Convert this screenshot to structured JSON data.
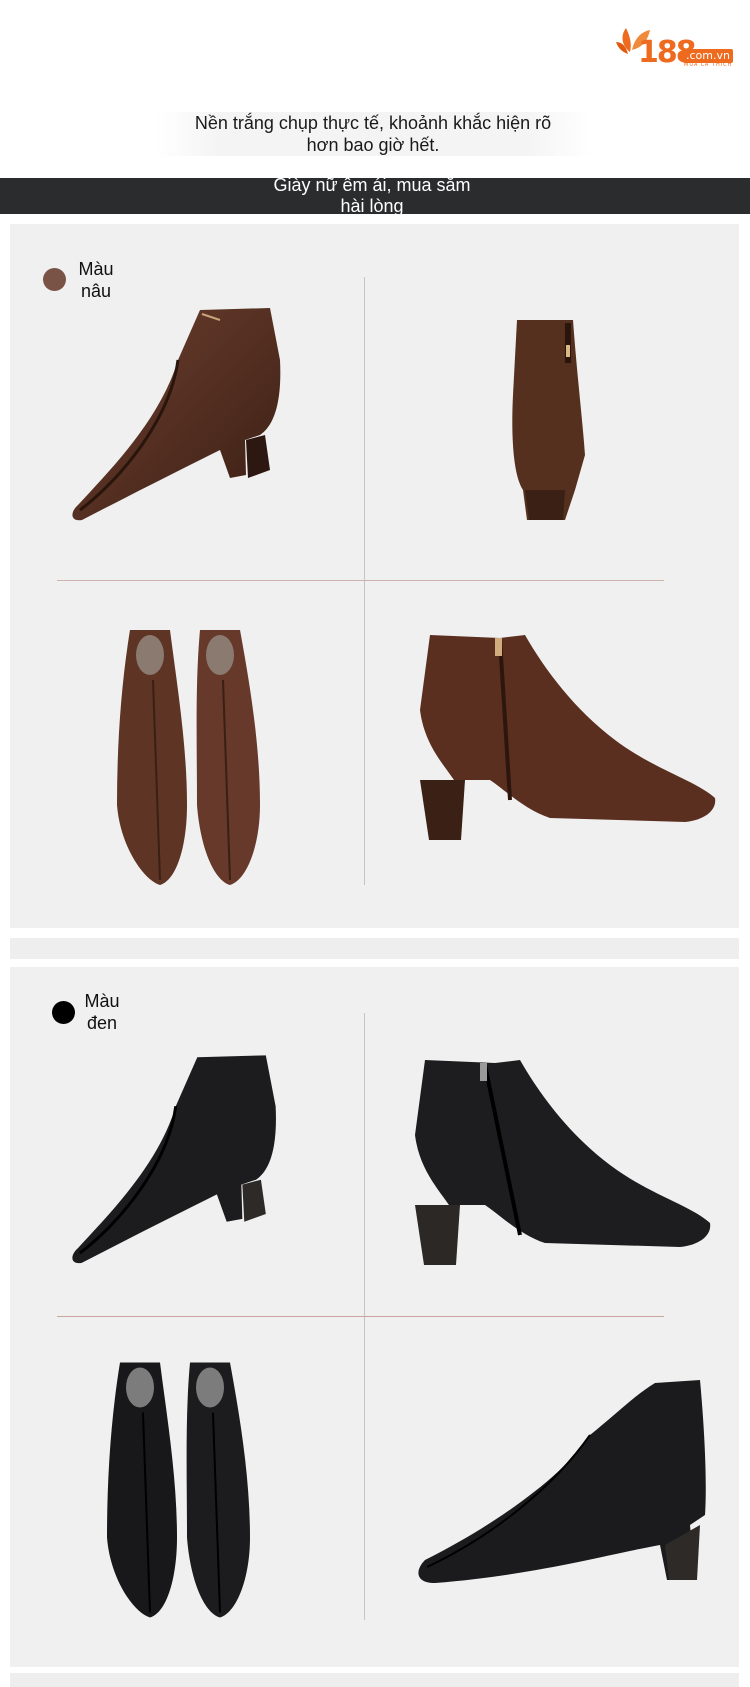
{
  "brand": {
    "logo_number": "188",
    "logo_domain": ".com.vn",
    "logo_tagline": "MUA LÀ THÍCH",
    "accent_color": "#ee6a1f"
  },
  "intro": {
    "line1": "Nền trắng chụp thực tế, khoảnh khắc hiện rõ",
    "line2": "hơn bao giờ hết."
  },
  "slogan": {
    "line1": "Giày nữ êm ái, mua sắm",
    "line2": "hài lòng"
  },
  "colors": [
    {
      "label_line1": "Màu",
      "label_line2": "nâu",
      "swatch": "#7a5347"
    },
    {
      "label_line1": "Màu",
      "label_line2": "đen",
      "swatch": "#000000"
    }
  ]
}
